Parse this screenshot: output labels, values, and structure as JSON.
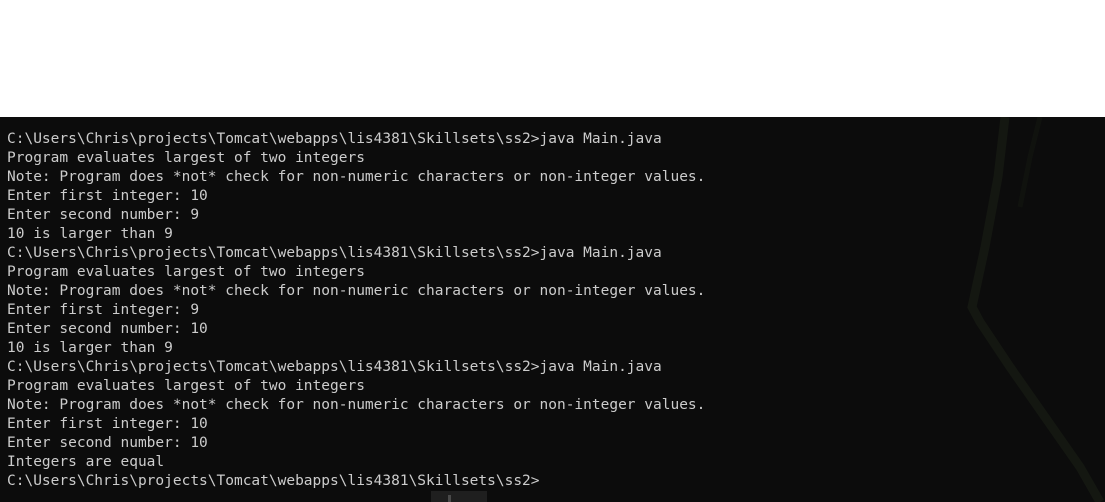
{
  "terminal": {
    "lines": [
      "C:\\Users\\Chris\\projects\\Tomcat\\webapps\\lis4381\\Skillsets\\ss2>java Main.java",
      "Program evaluates largest of two integers",
      "Note: Program does *not* check for non-numeric characters or non-integer values.",
      "Enter first integer: 10",
      "Enter second number: 9",
      "10 is larger than 9",
      "C:\\Users\\Chris\\projects\\Tomcat\\webapps\\lis4381\\Skillsets\\ss2>java Main.java",
      "Program evaluates largest of two integers",
      "Note: Program does *not* check for non-numeric characters or non-integer values.",
      "Enter first integer: 9",
      "Enter second number: 10",
      "10 is larger than 9",
      "C:\\Users\\Chris\\projects\\Tomcat\\webapps\\lis4381\\Skillsets\\ss2>java Main.java",
      "Program evaluates largest of two integers",
      "Note: Program does *not* check for non-numeric characters or non-integer values.",
      "Enter first integer: 10",
      "Enter second number: 10",
      "Integers are equal",
      "C:\\Users\\Chris\\projects\\Tomcat\\webapps\\lis4381\\Skillsets\\ss2>"
    ]
  },
  "colors": {
    "terminal_background": "#0c0c0c",
    "terminal_text": "#cccccc",
    "page_background": "#ffffff"
  }
}
